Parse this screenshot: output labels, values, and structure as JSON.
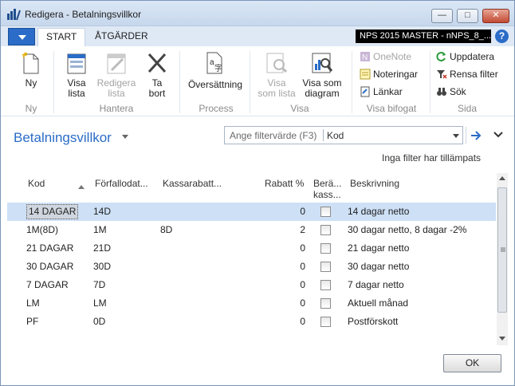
{
  "window": {
    "title": "Redigera - Betalningsvillkor",
    "minimize": "—",
    "maximize": "□",
    "close": "✕"
  },
  "tabs": {
    "start": "START",
    "actions": "ÅTGÄRDER"
  },
  "company": "NPS 2015 MASTER - nNPS_8_...",
  "help": "?",
  "ribbon": {
    "new_label": "Ny",
    "view_list_label_1": "Visa",
    "view_list_label_2": "lista",
    "edit_list_label_1": "Redigera",
    "edit_list_label_2": "lista",
    "delete_label_1": "Ta",
    "delete_label_2": "bort",
    "translation_label": "Översättning",
    "show_as_list_1": "Visa",
    "show_as_list_2": "som lista",
    "show_as_chart_1": "Visa som",
    "show_as_chart_2": "diagram",
    "onenote": "OneNote",
    "notes": "Noteringar",
    "links": "Länkar",
    "refresh": "Uppdatera",
    "clear_filter": "Rensa filter",
    "find": "Sök",
    "groups": {
      "new": "Ny",
      "manage": "Hantera",
      "process": "Process",
      "view": "Visa",
      "attached": "Visa bifogat",
      "page": "Sida"
    }
  },
  "page": {
    "title": "Betalningsvillkor",
    "no_filter": "Inga filter har tillämpats"
  },
  "filter": {
    "placeholder": "Ange filtervärde (F3)",
    "field": "Kod"
  },
  "columns": {
    "code": "Kod",
    "due_date": "Förfallodat...",
    "discount_date": "Kassarabatt...",
    "discount_pct": "Rabatt %",
    "calc_1": "Berä...",
    "calc_2": "kass...",
    "description": "Beskrivning"
  },
  "rows": [
    {
      "code": "14 DAGAR",
      "due": "14D",
      "disc": "",
      "pct": "0",
      "desc": "14 dagar netto",
      "selected": true
    },
    {
      "code": "1M(8D)",
      "due": "1M",
      "disc": "8D",
      "pct": "2",
      "desc": "30 dagar netto, 8 dagar -2%"
    },
    {
      "code": "21 DAGAR",
      "due": "21D",
      "disc": "",
      "pct": "0",
      "desc": "21 dagar netto"
    },
    {
      "code": "30 DAGAR",
      "due": "30D",
      "disc": "",
      "pct": "0",
      "desc": "30 dagar netto"
    },
    {
      "code": "7 DAGAR",
      "due": "7D",
      "disc": "",
      "pct": "0",
      "desc": "7 dagar netto"
    },
    {
      "code": "LM",
      "due": "LM",
      "disc": "",
      "pct": "0",
      "desc": "Aktuell månad"
    },
    {
      "code": "PF",
      "due": "0D",
      "disc": "",
      "pct": "0",
      "desc": "Postförskott"
    }
  ],
  "ok_label": "OK",
  "colors": {
    "accent": "#2a6cc7",
    "selection": "#cde0f6",
    "disabled": "#a4a4a4"
  }
}
